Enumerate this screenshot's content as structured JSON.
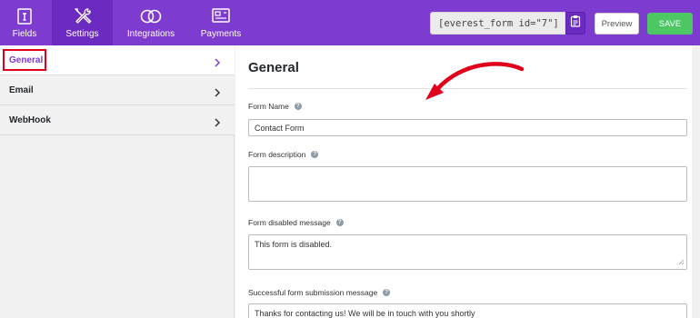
{
  "nav_tabs": [
    {
      "label": "Fields",
      "icon": "fields-icon"
    },
    {
      "label": "Settings",
      "icon": "settings-icon"
    },
    {
      "label": "Integrations",
      "icon": "integrations-icon"
    },
    {
      "label": "Payments",
      "icon": "payments-icon"
    }
  ],
  "header": {
    "shortcode": "[everest_form id=\"7\"]",
    "preview_label": "Preview",
    "save_label": "SAVE"
  },
  "sidebar": {
    "items": [
      {
        "label": "General"
      },
      {
        "label": "Email"
      },
      {
        "label": "WebHook"
      }
    ]
  },
  "main": {
    "title": "General",
    "fields": [
      {
        "label": "Form Name",
        "value": "Contact Form"
      },
      {
        "label": "Form description",
        "value": ""
      },
      {
        "label": "Form disabled message",
        "value": "This form is disabled."
      },
      {
        "label": "Successful form submission message",
        "value": "Thanks for contacting us! We will be in touch with you shortly"
      }
    ]
  },
  "colors": {
    "brand": "#7e3bd0",
    "save": "#4cc764",
    "annotation": "#e0001b"
  }
}
